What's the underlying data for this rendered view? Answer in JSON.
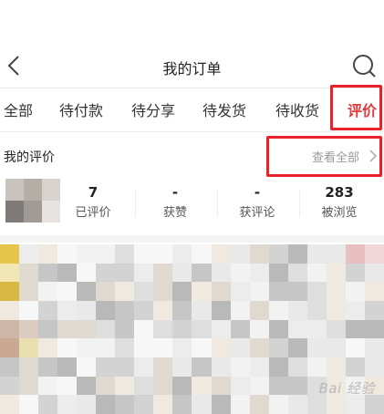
{
  "header": {
    "title": "我的订单"
  },
  "tabs": [
    {
      "label": "全部"
    },
    {
      "label": "待付款"
    },
    {
      "label": "待分享"
    },
    {
      "label": "待发货"
    },
    {
      "label": "待收货"
    },
    {
      "label": "评价"
    }
  ],
  "active_tab": "评价",
  "section": {
    "title": "我的评价",
    "view_all": "查看全部"
  },
  "stats": [
    {
      "value": "7",
      "label": "已评价"
    },
    {
      "value": "-",
      "label": "获赞"
    },
    {
      "value": "-",
      "label": "获评论"
    },
    {
      "value": "283",
      "label": "被浏览"
    }
  ],
  "watermark": "Bai 经验",
  "colors": {
    "accent": "#e4393c",
    "highlight_box": "#e8212a"
  },
  "icons": [
    "back-arrow-icon",
    "search-icon",
    "chevron-right-icon"
  ]
}
